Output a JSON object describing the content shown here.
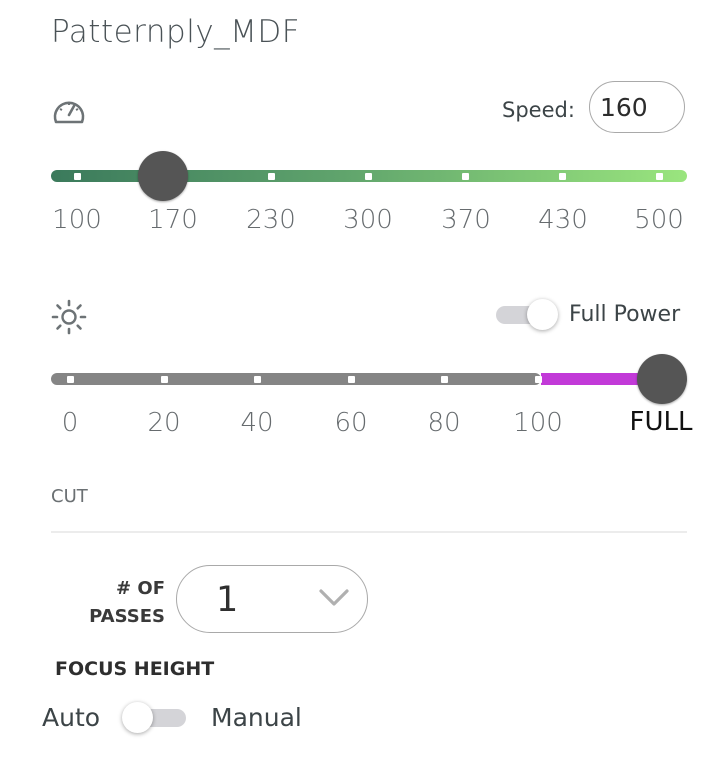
{
  "profile": {
    "name": "Patternply_MDF"
  },
  "speed": {
    "icon": "speedometer-icon",
    "label": "Speed:",
    "value": "160",
    "ticks": [
      "100",
      "170",
      "230",
      "300",
      "370",
      "430",
      "500"
    ]
  },
  "power": {
    "icon": "brightness-icon",
    "full_power_label": "Full Power",
    "full_power_enabled": true,
    "ticks": [
      "0",
      "20",
      "40",
      "60",
      "80",
      "100"
    ],
    "full_label": "FULL",
    "value": "FULL",
    "accent_color": "#c23ad8"
  },
  "section": {
    "label": "CUT"
  },
  "passes": {
    "label_line1": "# OF",
    "label_line2": "PASSES",
    "value": "1",
    "icon": "chevron-down-icon"
  },
  "focus": {
    "label": "FOCUS HEIGHT",
    "left_option": "Auto",
    "right_option": "Manual",
    "mode": "Auto"
  }
}
